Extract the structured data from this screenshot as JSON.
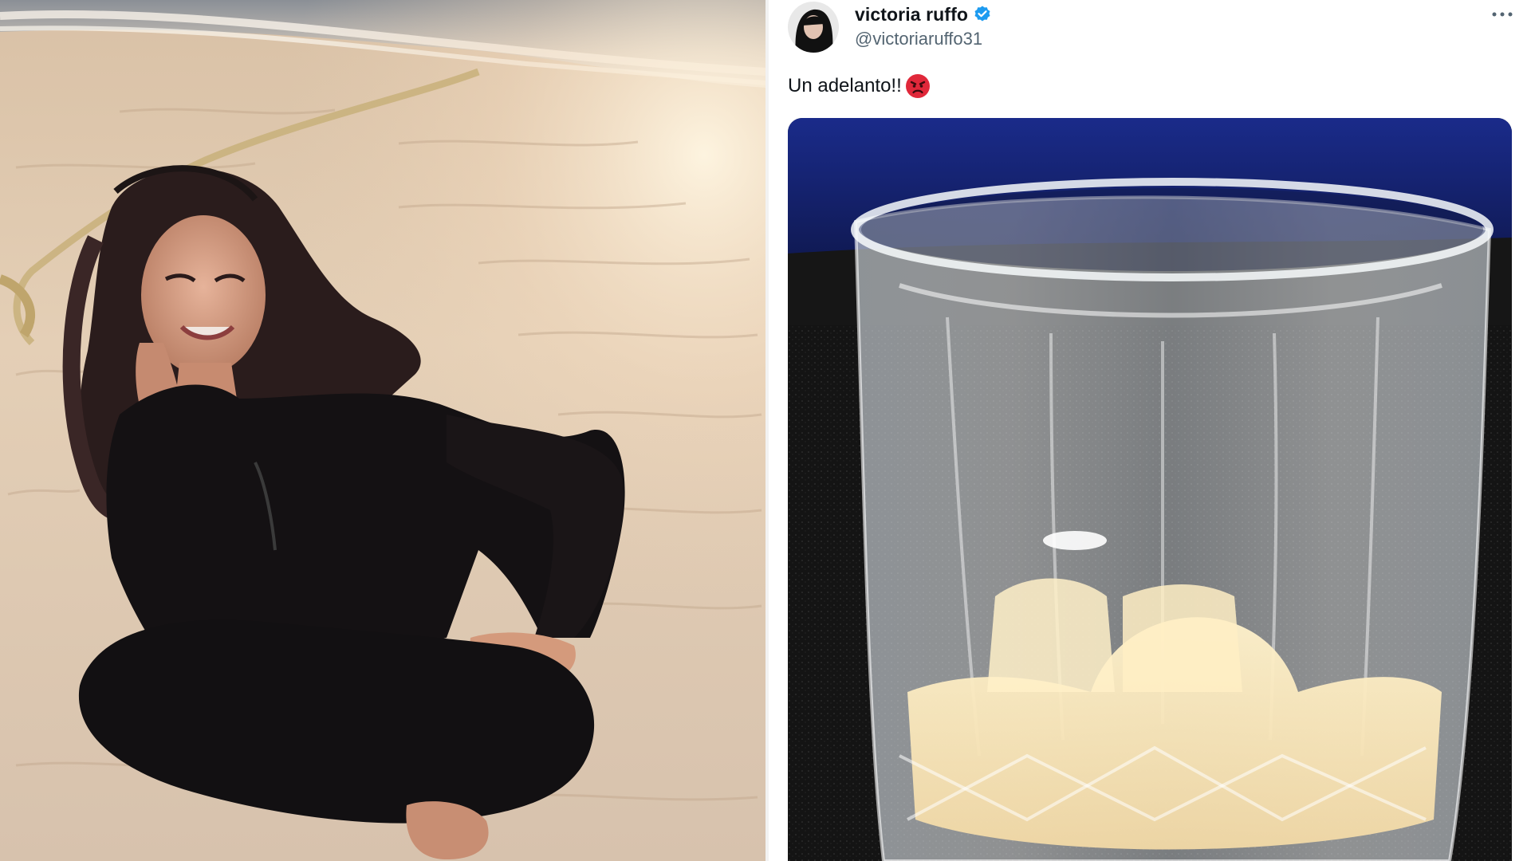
{
  "tweet": {
    "display_name": "victoria ruffo",
    "handle": "@victoriaruffo31",
    "text": "Un adelanto!!",
    "emoji": "angry-face"
  },
  "icons": {
    "verified": "verified-badge-icon",
    "more": "more-options-icon"
  },
  "colors": {
    "verified_blue": "#1d9bf0",
    "text_primary": "#0f1419",
    "text_secondary": "#536471"
  }
}
